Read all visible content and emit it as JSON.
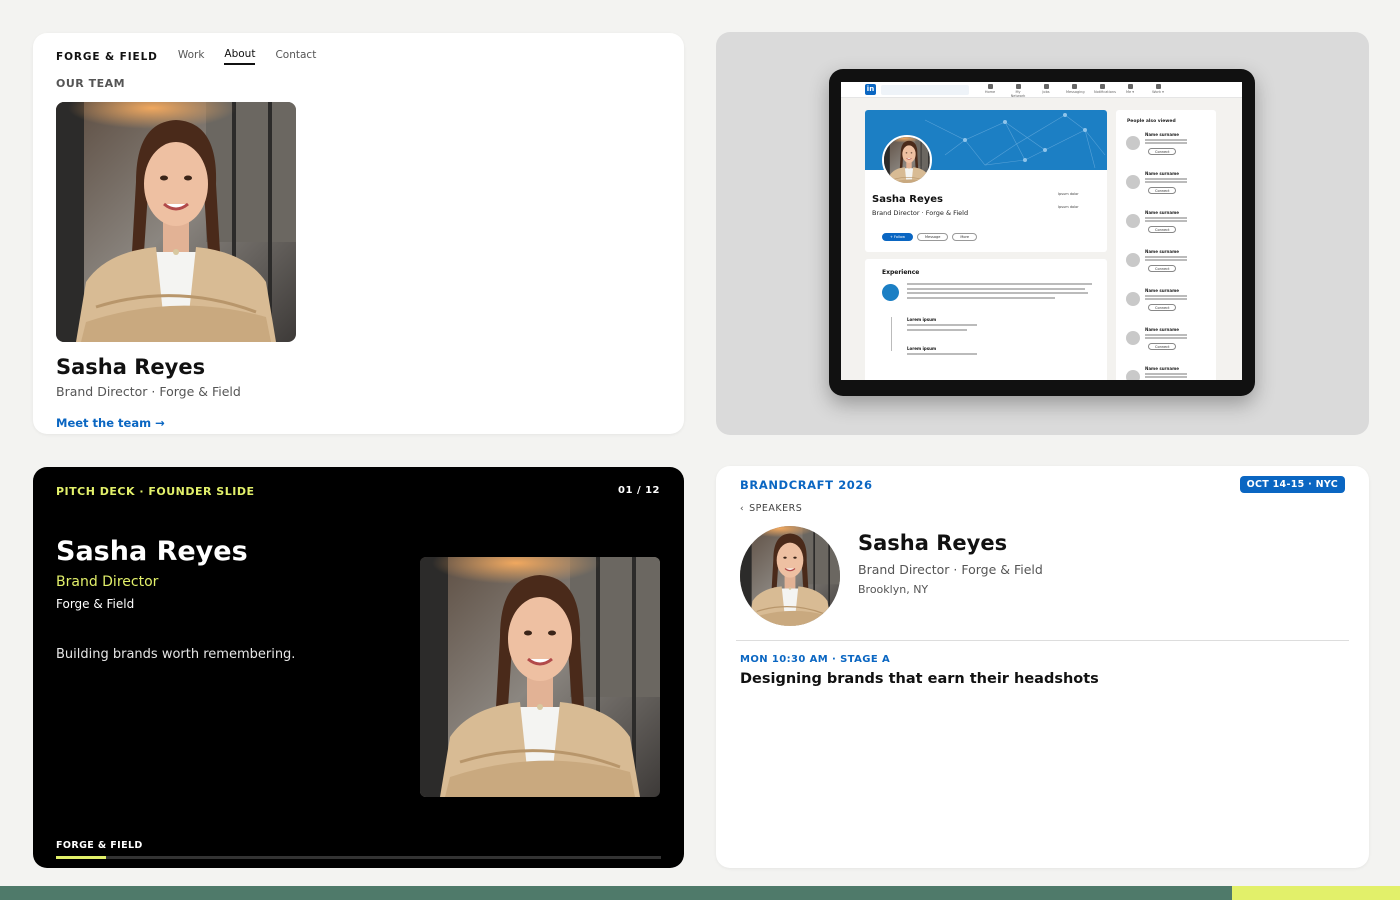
{
  "team_page": {
    "brand": "FORGE & FIELD",
    "nav": [
      "Work",
      "About",
      "Contact"
    ],
    "active_nav": "About",
    "section_label": "OUR TEAM",
    "name": "Sasha Reyes",
    "role": "Brand Director · Forge & Field",
    "link": "Meet the team →"
  },
  "linkedin_mock": {
    "logo": "in",
    "nav": [
      "Home",
      "My Network",
      "Jobs",
      "Messaging",
      "Notifications",
      "Me ▾",
      "Work ▾"
    ],
    "name": "Sasha Reyes",
    "headline": "Brand Director · Forge & Field",
    "side_items": [
      "Ipsum dolor",
      "Ipsum dolor"
    ],
    "buttons": [
      "+ Follow",
      "Message",
      "More"
    ],
    "experience_title": "Experience",
    "experience_items": [
      "Lorem ipsum",
      "Lorem ipsum"
    ],
    "sidebar_title": "People also viewed",
    "people": [
      "Name surname",
      "Name surname",
      "Name surname",
      "Name surname",
      "Name surname",
      "Name surname",
      "Name surname"
    ],
    "connect_label": "Connect"
  },
  "pitch_deck": {
    "eyebrow": "PITCH DECK · FOUNDER SLIDE",
    "page": "01 / 12",
    "name": "Sasha Reyes",
    "role": "Brand Director",
    "org": "Forge & Field",
    "tagline": "Building brands worth remembering.",
    "footer": "FORGE & FIELD",
    "progress": 0.083
  },
  "speaker_page": {
    "conference": "BRANDCRAFT 2026",
    "badge": "OCT 14-15 · NYC",
    "back": "SPEAKERS",
    "name": "Sasha Reyes",
    "role": "Brand Director · Forge & Field",
    "location": "Brooklyn, NY",
    "session_meta": "MON 10:30 AM · STAGE A",
    "session_title": "Designing brands that earn their headshots"
  },
  "colors": {
    "accent_blue": "#0a66c2",
    "accent_lime": "#e2f06a",
    "strip_green": "#4f7a6a"
  }
}
